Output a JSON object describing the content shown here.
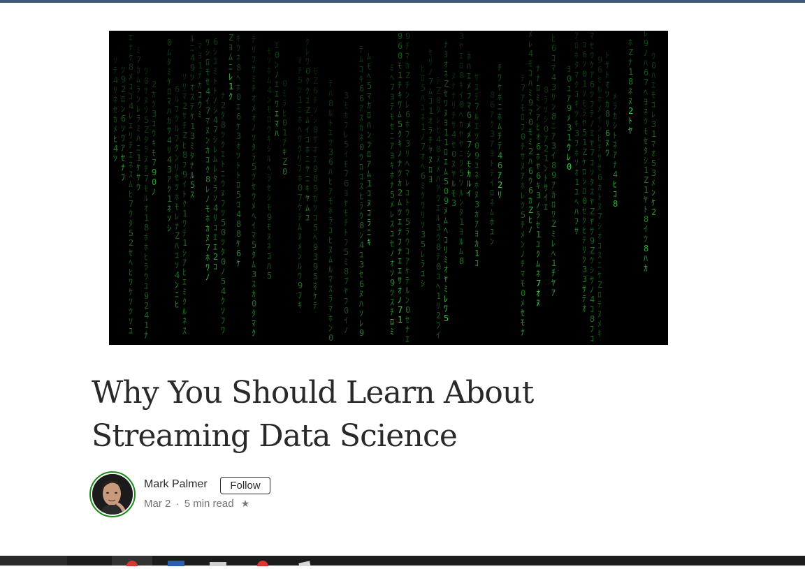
{
  "article": {
    "title": "Why You Should Learn About Streaming Data Science",
    "hero_alt": "matrix-code-image"
  },
  "author": {
    "name": "Mark Palmer",
    "follow_label": "Follow",
    "date": "Mar 2",
    "separator": "·",
    "read_time": "5 min read",
    "star": "★"
  },
  "colors": {
    "top_bar": "#3b5a7c",
    "matrix_green": "#3fd34a",
    "title_text": "#292929",
    "meta_text": "#757575"
  },
  "matrix": {
    "glyphs": "0123456789ｱｲｳｴｵｶｷｸｹｺｻｼｽｾｿﾀﾁﾂﾃﾄﾅﾆﾇﾈﾉﾊﾋﾌﾍﾎﾏﾐﾑﾒﾓﾔﾕﾖﾗﾘﾙﾚﾛﾜﾝZ"
  },
  "taskbar": {
    "icons": [
      "start-icon",
      "chrome-icon",
      "word-icon",
      "mail-icon",
      "opera-icon",
      "files-icon"
    ]
  }
}
